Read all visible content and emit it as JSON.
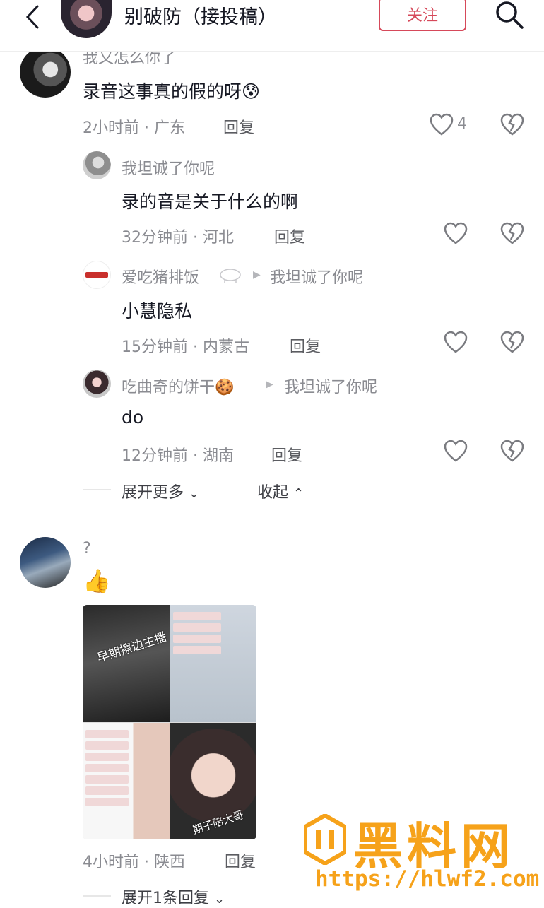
{
  "header": {
    "title": "别破防（接投稿）",
    "follow_label": "关注"
  },
  "comment1": {
    "name": "我又怎么你了",
    "text": "录音这事真的假的呀😰",
    "time": "2小时前 · 广东",
    "reply_label": "回复",
    "like_count": "4",
    "replies": [
      {
        "name": "我坦诚了你呢",
        "text": "录的音是关于什么的啊",
        "time": "32分钟前 · 河北",
        "reply_label": "回复"
      },
      {
        "name": "爱吃猪排饭",
        "to": "我坦诚了你呢",
        "text": "小慧隐私",
        "time": "15分钟前 · 内蒙古",
        "reply_label": "回复"
      },
      {
        "name": "吃曲奇的饼干🍪",
        "to": "我坦诚了你呢",
        "text": "do",
        "time": "12分钟前 · 湖南",
        "reply_label": "回复"
      }
    ],
    "expand_more": "展开更多",
    "collapse": "收起"
  },
  "comment2": {
    "name": "?",
    "emoji": "👍",
    "image_caption": "早期擦边主播",
    "image_caption2": "期子陪大哥",
    "time": "4小时前 · 陕西",
    "reply_label": "回复",
    "expand_replies": "展开1条回复"
  },
  "watermark": {
    "brand": "黑料网",
    "url": "https://hlwf2.com"
  },
  "colors": {
    "accent": "#d6495a",
    "watermark": "#f6a21a",
    "meta_gray": "#8a8b91"
  }
}
